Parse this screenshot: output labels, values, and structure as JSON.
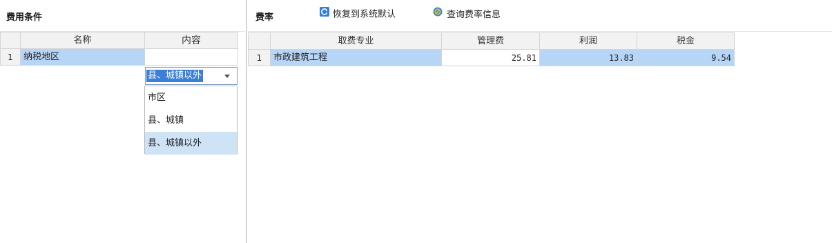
{
  "left": {
    "title": "费用条件",
    "columns": {
      "name": "名称",
      "content": "内容"
    },
    "rows": [
      {
        "num": "1",
        "name": "纳税地区",
        "content": "县、城镇以外"
      }
    ],
    "dropdown": {
      "options": [
        "市区",
        "县、城镇",
        "县、城镇以外"
      ],
      "selected_index": 2
    }
  },
  "right": {
    "title": "费率",
    "toolbar": {
      "restore_label": "恢复到系统默认",
      "restore_icon": "restore-icon",
      "query_label": "查询费率信息",
      "query_icon": "query-icon"
    },
    "columns": [
      "取费专业",
      "管理费",
      "利润",
      "税金"
    ],
    "rows": [
      {
        "num": "1",
        "specialty": "市政建筑工程",
        "mgmt_fee": "25.81",
        "profit": "13.83",
        "tax": "9.54"
      }
    ]
  },
  "colors": {
    "accent_header": "#fde3c4",
    "selection": "#b7d5f7",
    "selection_text_bg": "#3b7fd8",
    "restore_icon": "#2f7ee0",
    "query_icon_bg": "#2d8de8",
    "query_icon_fg": "#f5b21f"
  }
}
